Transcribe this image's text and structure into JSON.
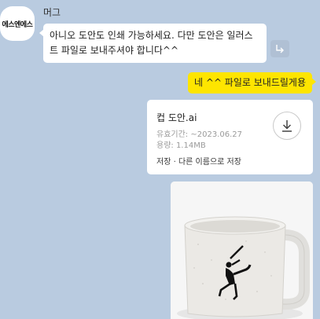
{
  "received": {
    "avatar_text": "에스엔에스",
    "sender": "머그",
    "message": "아니오 도안도 인쇄 가능하세요. 다만 도안은 일러스트 파일로 보내주셔야 합니다^^"
  },
  "sent": {
    "message": "네 ^^ 파일로 보내드릴게용"
  },
  "file": {
    "name": "컵 도안.ai",
    "expiry": "유효기간: ~2023.06.27",
    "size": "용량: 1.14MB",
    "save_label": "저장",
    "separator": "·",
    "save_as_label": "다른 이름으로 저장"
  },
  "colors": {
    "background": "#b9cbe0",
    "sent_bubble": "#fee500",
    "received_bubble": "#ffffff"
  },
  "icons": {
    "share": "share-arrow-icon",
    "download": "download-icon"
  }
}
